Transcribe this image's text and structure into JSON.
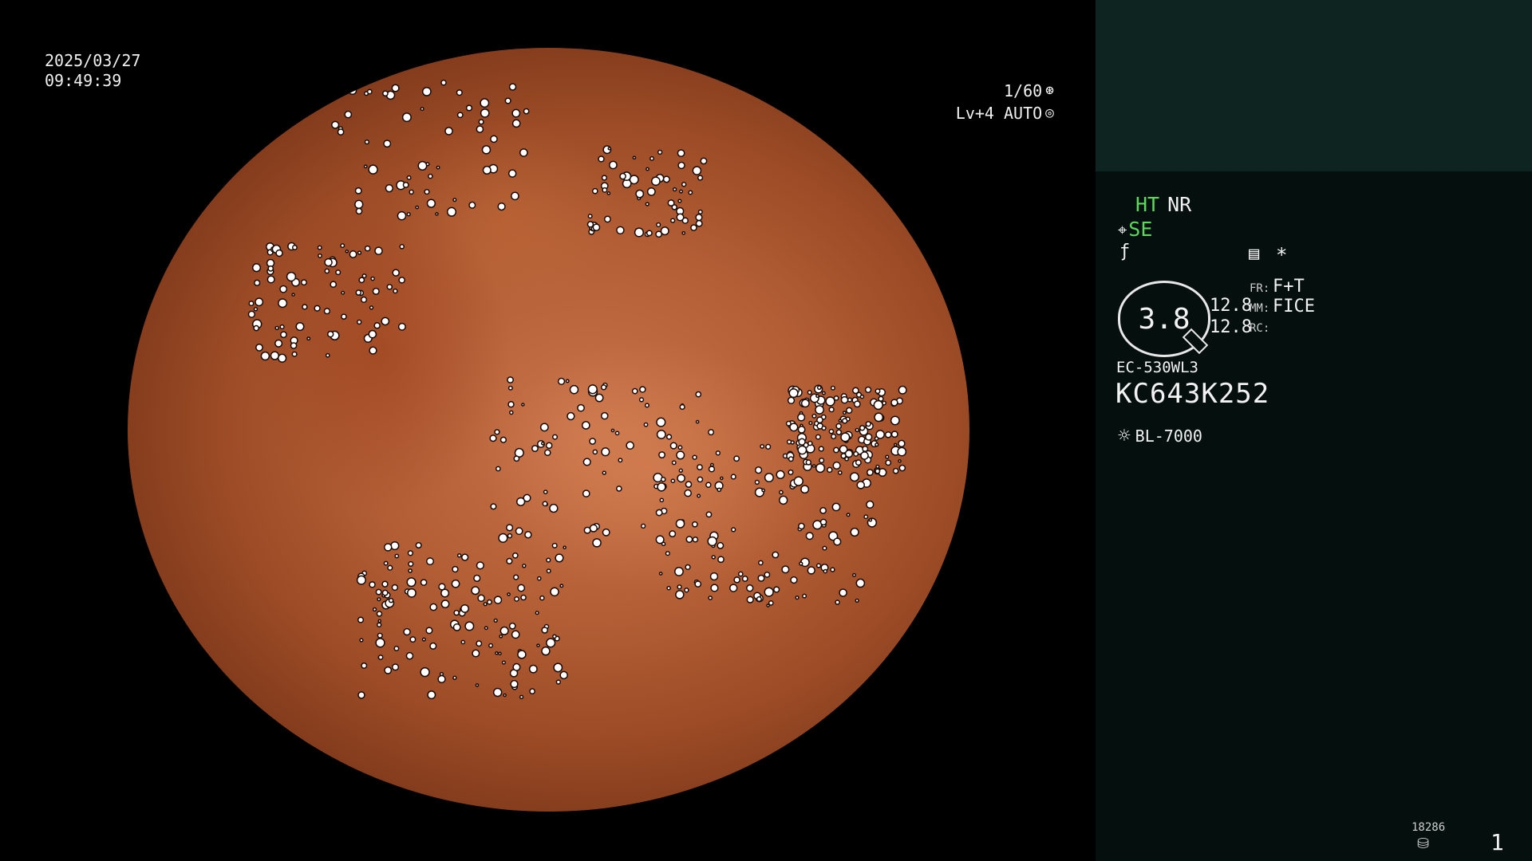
{
  "overlay": {
    "date": "2025/03/27",
    "time": "09:49:39",
    "shutter": "1/60",
    "shutter_icon": "shutter-icon",
    "iris": "Lv+4 AUTO",
    "iris_icon": "iris-icon"
  },
  "panel": {
    "ht": "HT",
    "nr": "NR",
    "se_icon": "enhance-icon",
    "se": "SE",
    "f_icon": "f-icon",
    "memo_icon": "memo-icon",
    "star": "*",
    "dial_value": "3.8",
    "fr_label": "FR:",
    "fr_value": "F+T",
    "mm_label": "MM:",
    "mm_value": "FICE",
    "rc_label": "RC:",
    "num1": "12.8",
    "num2": "12.8",
    "model": "EC-530WL3",
    "serial": "KC643K252",
    "light_icon": "light-source-icon",
    "light_source": "BL-7000",
    "counter": "18286",
    "disk_icon": "disk-icon",
    "page": "1"
  },
  "colors": {
    "accent_green": "#5cd85c",
    "panel_bg": "#050f0d",
    "panel_top_bg": "#0e2420"
  }
}
